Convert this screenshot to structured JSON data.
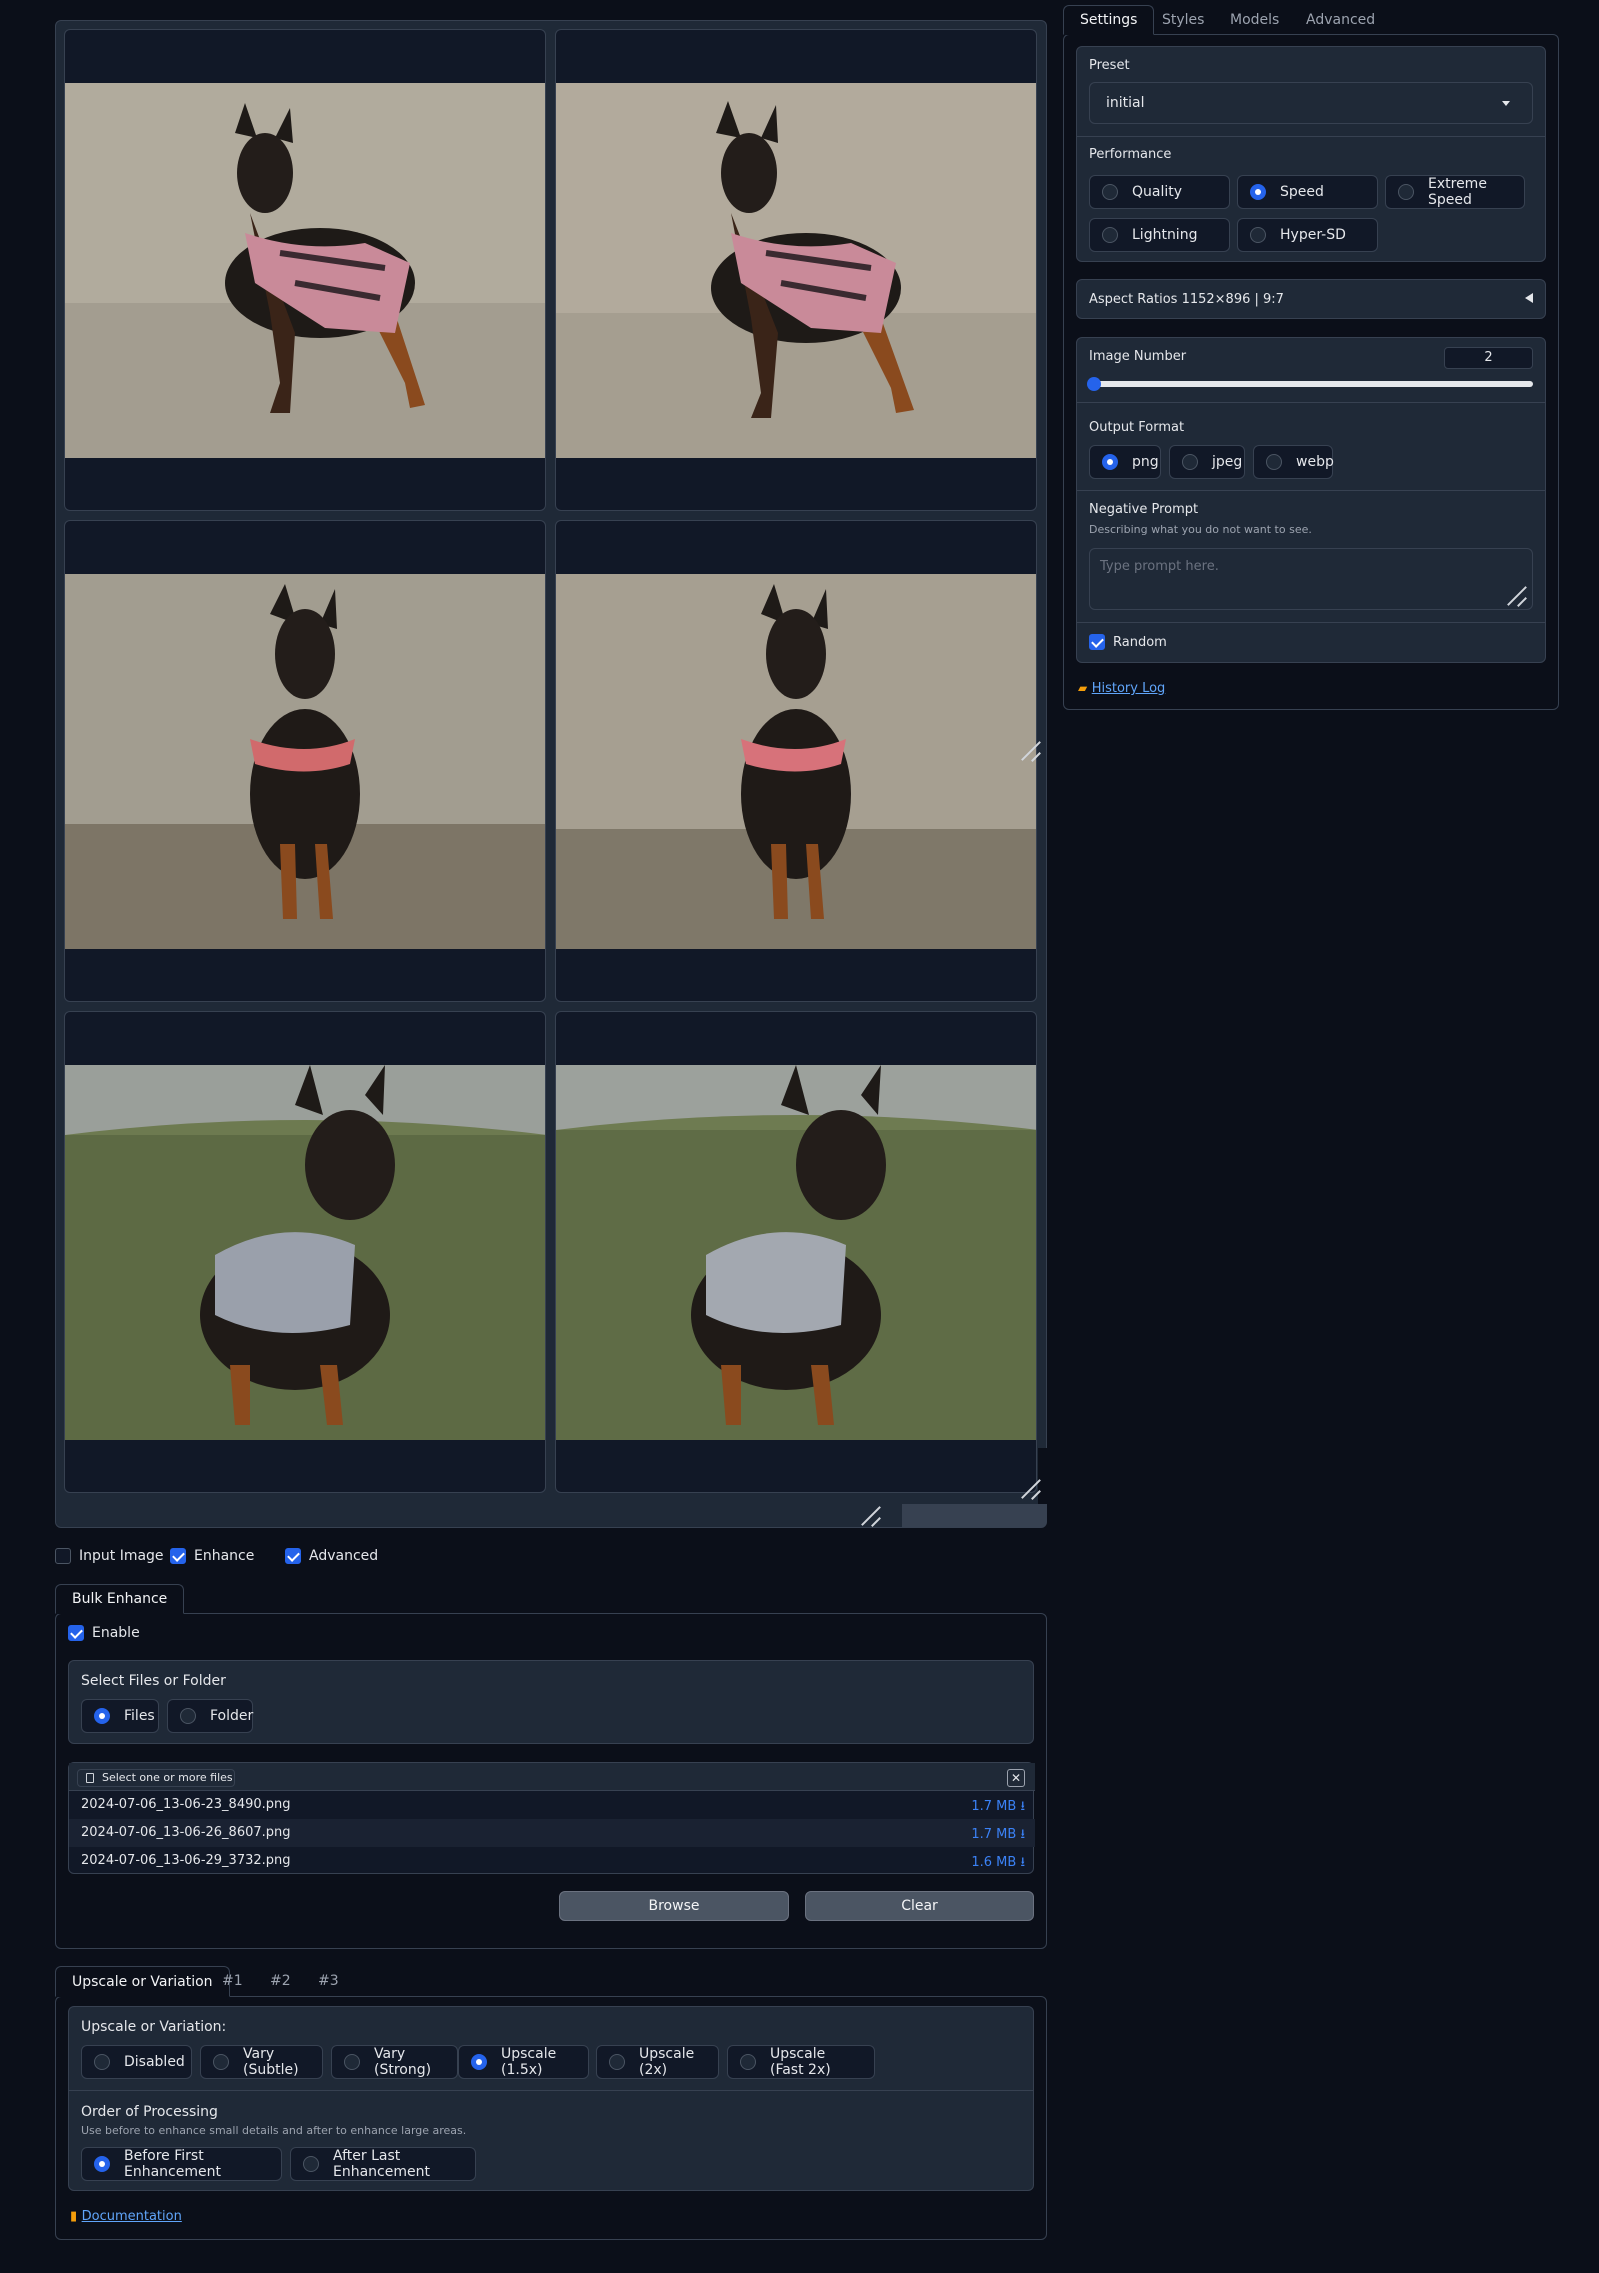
{
  "gallery": {
    "images": [
      {
        "alt": "Doberman in pink patterned vest, studio wall"
      },
      {
        "alt": "Doberman in pink patterned vest, studio wall"
      },
      {
        "alt": "Doberman in red collar vest, standing"
      },
      {
        "alt": "Doberman in red collar vest, standing"
      },
      {
        "alt": "Doberman in gray vest, grass field"
      },
      {
        "alt": "Doberman in gray vest, grass field"
      }
    ]
  },
  "toggles": {
    "input_image": "Input Image",
    "enhance": "Enhance",
    "advanced": "Advanced"
  },
  "bulk": {
    "tab": "Bulk Enhance",
    "enable": "Enable",
    "select_title": "Select Files or Folder",
    "options": [
      "Files",
      "Folder"
    ],
    "upload_label": "Select one or more files",
    "files": [
      {
        "name": "2024-07-06_13-06-23_8490.png",
        "size": "1.7 MB"
      },
      {
        "name": "2024-07-06_13-06-26_8607.png",
        "size": "1.7 MB"
      },
      {
        "name": "2024-07-06_13-06-29_3732.png",
        "size": "1.6 MB"
      }
    ],
    "browse": "Browse",
    "clear": "Clear"
  },
  "upscale": {
    "tabs": [
      "Upscale or Variation",
      "#1",
      "#2",
      "#3"
    ],
    "title": "Upscale or Variation:",
    "options": [
      "Disabled",
      "Vary (Subtle)",
      "Vary (Strong)",
      "Upscale (1.5x)",
      "Upscale (2x)",
      "Upscale (Fast 2x)"
    ],
    "selected": "Upscale (1.5x)",
    "order_title": "Order of Processing",
    "order_sub": "Use before to enhance small details and after to enhance large areas.",
    "order_options": [
      "Before First Enhancement",
      "After Last Enhancement"
    ],
    "documentation": "Documentation"
  },
  "settings": {
    "tabs": [
      "Settings",
      "Styles",
      "Models",
      "Advanced"
    ],
    "preset_label": "Preset",
    "preset_value": "initial",
    "performance_label": "Performance",
    "performance_options": [
      "Quality",
      "Speed",
      "Extreme Speed",
      "Lightning",
      "Hyper-SD"
    ],
    "performance_selected": "Speed",
    "aspect_ratios": "Aspect Ratios 1152×896 | 9:7",
    "image_number_label": "Image Number",
    "image_number": "2",
    "image_number_fraction": 0.0,
    "output_format_label": "Output Format",
    "output_formats": [
      "png",
      "jpeg",
      "webp"
    ],
    "output_selected": "png",
    "negative_prompt_label": "Negative Prompt",
    "negative_prompt_sub": "Describing what you do not want to see.",
    "negative_prompt_placeholder": "Type prompt here.",
    "random": "Random",
    "history_log": "History Log"
  },
  "colors": {
    "accent": "#2563eb",
    "background": "#0b0f19",
    "block": "#1f2937",
    "link": "#60a5fa"
  }
}
